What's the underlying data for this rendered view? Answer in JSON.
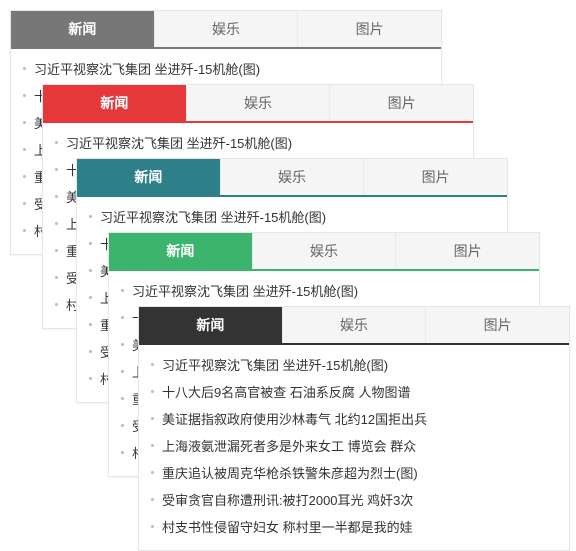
{
  "tabs": [
    "新闻",
    "娱乐",
    "图片"
  ],
  "items": [
    "习近平视察沈飞集团 坐进歼-15机舱(图)",
    "十八大后9名高官被查 石油系反腐 人物图谱",
    "美证据指叙政府使用沙林毒气 北约12国拒出兵",
    "上海液氨泄漏死者多是外来女工 博览会 群众",
    "重庆追认被周克华枪杀铁警朱彦超为烈士(图)",
    "受审贪官自称遭刑讯:被打2000耳光 鸡奸3次",
    "村支书性侵留守妇女 称村里一半都是我的娃"
  ],
  "cards": [
    {
      "theme": "theme-gray"
    },
    {
      "theme": "theme-red"
    },
    {
      "theme": "theme-teal"
    },
    {
      "theme": "theme-green"
    },
    {
      "theme": "theme-black"
    }
  ]
}
